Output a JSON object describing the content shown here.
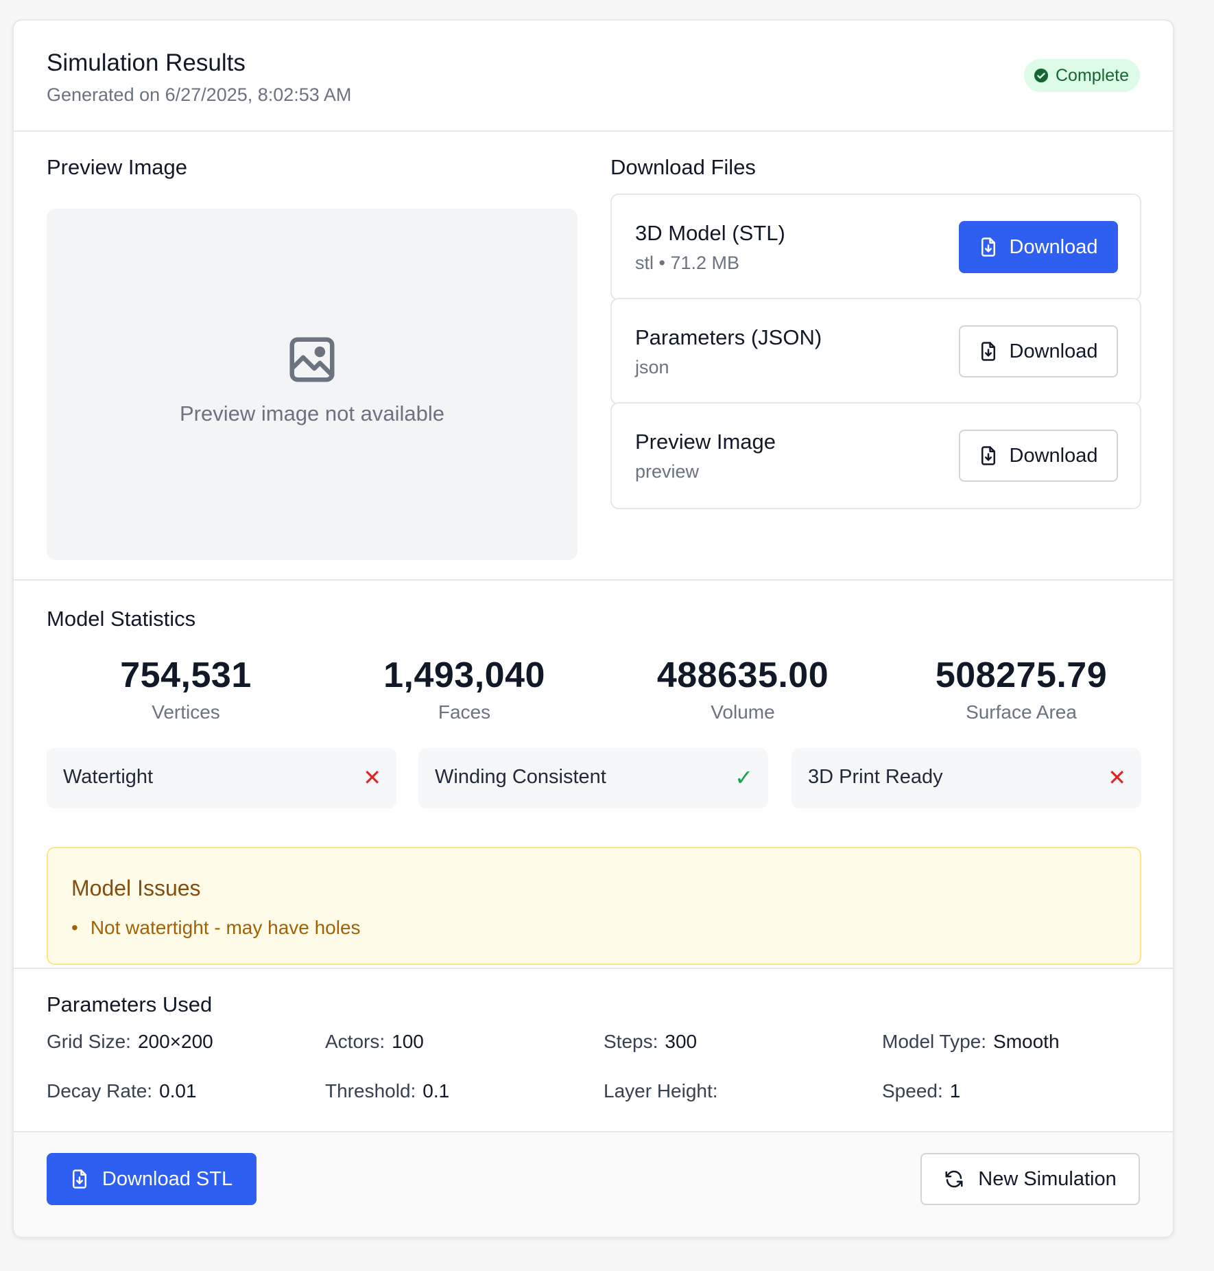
{
  "header": {
    "title": "Simulation Results",
    "subtitle": "Generated on 6/27/2025, 8:02:53 AM",
    "status": "Complete",
    "status_color": "#166534"
  },
  "preview": {
    "heading": "Preview Image",
    "placeholder_text": "Preview image not available",
    "icon": "image-icon"
  },
  "downloads": {
    "heading": "Download Files",
    "files": [
      {
        "name": "3D Model (STL)",
        "meta": "stl • 71.2 MB",
        "button": "Download"
      },
      {
        "name": "Parameters (JSON)",
        "meta": "json",
        "button": "Download"
      },
      {
        "name": "Preview Image",
        "meta": "preview",
        "button": "Download"
      }
    ]
  },
  "stats": {
    "heading": "Model Statistics",
    "items": [
      {
        "value": "754,531",
        "label": "Vertices"
      },
      {
        "value": "1,493,040",
        "label": "Faces"
      },
      {
        "value": "488635.00",
        "label": "Volume"
      },
      {
        "value": "508275.79",
        "label": "Surface Area"
      }
    ],
    "checks": [
      {
        "label": "Watertight",
        "mark": "✕"
      },
      {
        "label": "Winding Consistent",
        "mark": "✓"
      },
      {
        "label": "3D Print Ready",
        "mark": "✕"
      }
    ]
  },
  "issues": {
    "title": "Model Issues",
    "items": [
      "Not watertight - may have holes"
    ]
  },
  "params": {
    "heading": "Parameters Used",
    "items": [
      {
        "key": "Grid Size:",
        "value": "200×200"
      },
      {
        "key": "Actors:",
        "value": "100"
      },
      {
        "key": "Steps:",
        "value": "300"
      },
      {
        "key": "Model Type:",
        "value": "Smooth"
      },
      {
        "key": "Decay Rate:",
        "value": "0.01"
      },
      {
        "key": "Threshold:",
        "value": "0.1"
      },
      {
        "key": "Layer Height:",
        "value": ""
      },
      {
        "key": "Speed:",
        "value": "1"
      }
    ]
  },
  "footer": {
    "download_stl": "Download STL",
    "new_simulation": "New Simulation"
  },
  "colors": {
    "accent": "#2f5ff0",
    "error": "#dc2626",
    "success": "#16a34a",
    "warning_bg": "#fefce8"
  }
}
